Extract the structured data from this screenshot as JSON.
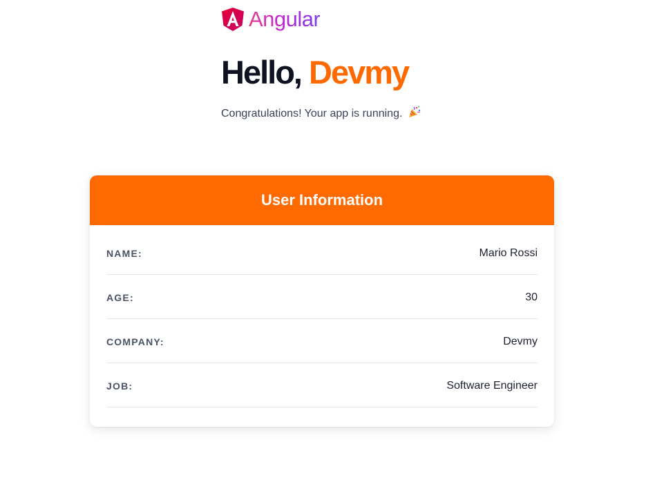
{
  "logo": {
    "text": "Angular",
    "icon": "angular-shield-icon"
  },
  "hero": {
    "greeting": "Hello,",
    "name": "Devmy",
    "subtitle": "Congratulations! Your app is running.",
    "subtitle_icon": "party-popper-icon"
  },
  "card": {
    "title": "User Information",
    "rows": [
      {
        "label": "NAME:",
        "value": "Mario Rossi"
      },
      {
        "label": "AGE:",
        "value": "30"
      },
      {
        "label": "COMPANY:",
        "value": "Devmy"
      },
      {
        "label": "JOB:",
        "value": "Software Engineer"
      }
    ]
  },
  "colors": {
    "accent": "#ff6a00",
    "heading": "#0f1220",
    "body_text": "#38405a",
    "label": "#4b5266",
    "divider": "#e5e7eb"
  }
}
